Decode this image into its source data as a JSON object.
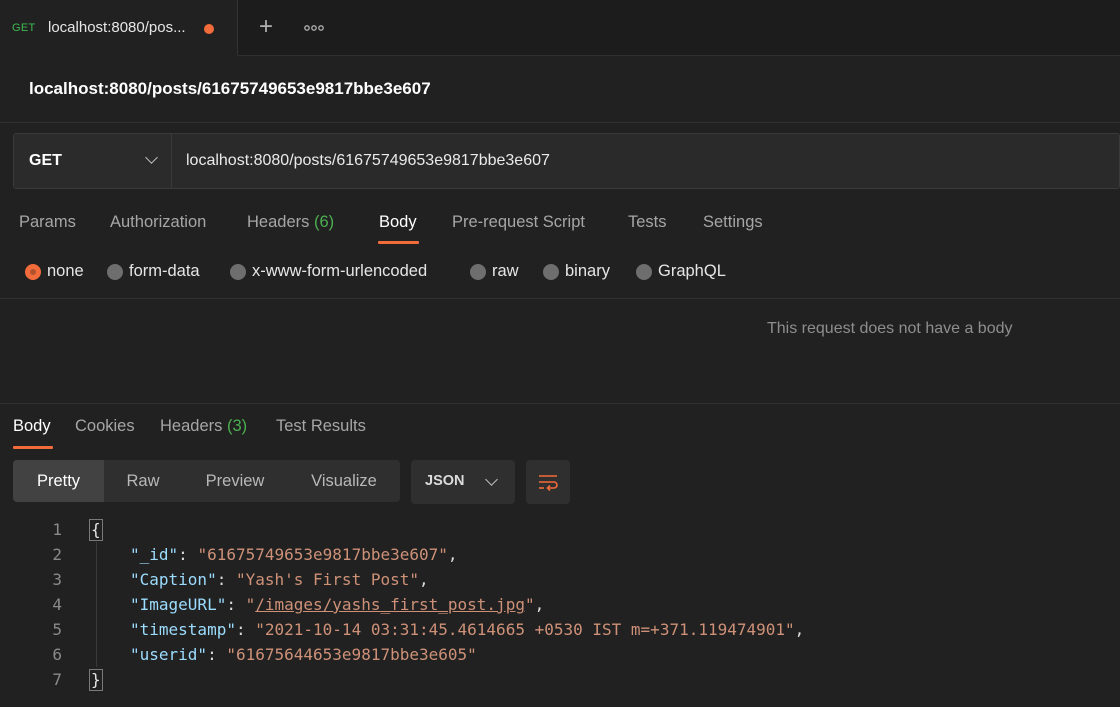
{
  "tab": {
    "method": "GET",
    "title": "localhost:8080/pos...",
    "add_icon": "plus-icon",
    "more_icon": "ellipsis-icon"
  },
  "request": {
    "title": "localhost:8080/posts/61675749653e9817bbe3e607",
    "method": "GET",
    "url": "localhost:8080/posts/61675749653e9817bbe3e607"
  },
  "request_tabs": [
    {
      "label": "Params"
    },
    {
      "label": "Authorization"
    },
    {
      "label": "Headers",
      "count": "(6)"
    },
    {
      "label": "Body",
      "active": true
    },
    {
      "label": "Pre-request Script"
    },
    {
      "label": "Tests"
    },
    {
      "label": "Settings"
    }
  ],
  "body_types": [
    {
      "label": "none",
      "selected": true
    },
    {
      "label": "form-data"
    },
    {
      "label": "x-www-form-urlencoded"
    },
    {
      "label": "raw"
    },
    {
      "label": "binary"
    },
    {
      "label": "GraphQL"
    }
  ],
  "no_body_message": "This request does not have a body",
  "response_tabs": [
    {
      "label": "Body",
      "active": true
    },
    {
      "label": "Cookies"
    },
    {
      "label": "Headers",
      "count": "(3)"
    },
    {
      "label": "Test Results"
    }
  ],
  "view_modes": [
    "Pretty",
    "Raw",
    "Preview",
    "Visualize"
  ],
  "active_view": "Pretty",
  "format": "JSON",
  "wrap_icon": "wrap-lines-icon",
  "code": {
    "line_numbers": [
      "1",
      "2",
      "3",
      "4",
      "5",
      "6",
      "7"
    ],
    "open_brace": "{",
    "close_brace": "}",
    "fields": [
      {
        "key": "\"_id\"",
        "value": "\"61675749653e9817bbe3e607\"",
        "comma": ","
      },
      {
        "key": "\"Caption\"",
        "value": "\"Yash's First Post\"",
        "comma": ","
      },
      {
        "key": "\"ImageURL\"",
        "value_q1": "\"",
        "value_link": "/images/yashs_first_post.jpg",
        "value_q2": "\"",
        "comma": ","
      },
      {
        "key": "\"timestamp\"",
        "value": "\"2021-10-14 03:31:45.4614665 +0530 IST m=+371.119474901\"",
        "comma": ","
      },
      {
        "key": "\"userid\"",
        "value": "\"61675644653e9817bbe3e605\"",
        "comma": ""
      }
    ]
  },
  "colors": {
    "accent": "#f26b3a",
    "count_green": "#4caf50",
    "json_key": "#9cdcfe",
    "json_string": "#ce9178"
  }
}
